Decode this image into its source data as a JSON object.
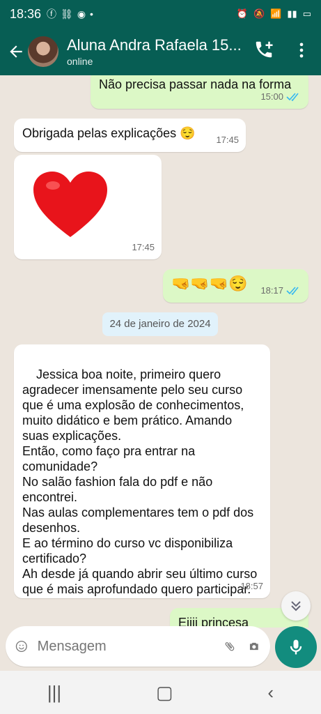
{
  "status": {
    "time": "18:36",
    "left_icons": [
      "facebook-icon",
      "link-icon",
      "whatsapp-icon",
      "dot-icon"
    ],
    "right_icons": [
      "alarm-icon",
      "alarm-icon",
      "mute-icon",
      "wifi-icon",
      "volte-icon",
      "signal-icon",
      "signal-icon",
      "battery-icon"
    ]
  },
  "header": {
    "title": "Aluna Andra Rafaela 15...",
    "subtitle": "online"
  },
  "messages": [
    {
      "type": "out",
      "text": "Não precisa passar nada na forma",
      "time": "15:00"
    },
    {
      "type": "in",
      "text": "Obrigada pelas explicações 😌",
      "time": "17:45"
    },
    {
      "type": "in-emoji",
      "text": "❤️",
      "time": "17:45"
    },
    {
      "type": "out",
      "text": "🤜🤜🤜😌",
      "time": "18:17"
    },
    {
      "type": "date",
      "text": "24 de janeiro de 2024"
    },
    {
      "type": "in",
      "text": "Jessica boa noite, primeiro quero agradecer imensamente pelo seu curso que é uma explosão de conhecimentos, muito didático e bem prático. Amando suas explicações.\nEntão, como faço pra entrar na comunidade?\nNo salão fashion fala do pdf e não encontrei.\nNas aulas complementares tem o pdf dos desenhos.\nE ao término do curso vc disponibiliza certificado?\nAh desde já quando abrir seu último curso que é mais aprofundado quero participar.",
      "time": "18:57"
    },
    {
      "type": "out",
      "text": "Eiiii princesa",
      "time": ""
    }
  ],
  "composer": {
    "placeholder": "Mensagem"
  },
  "colors": {
    "header": "#075e54",
    "outgoing": "#dcf8c6",
    "incoming": "#ffffff",
    "mic": "#128c7e",
    "tick": "#34b7f1"
  }
}
